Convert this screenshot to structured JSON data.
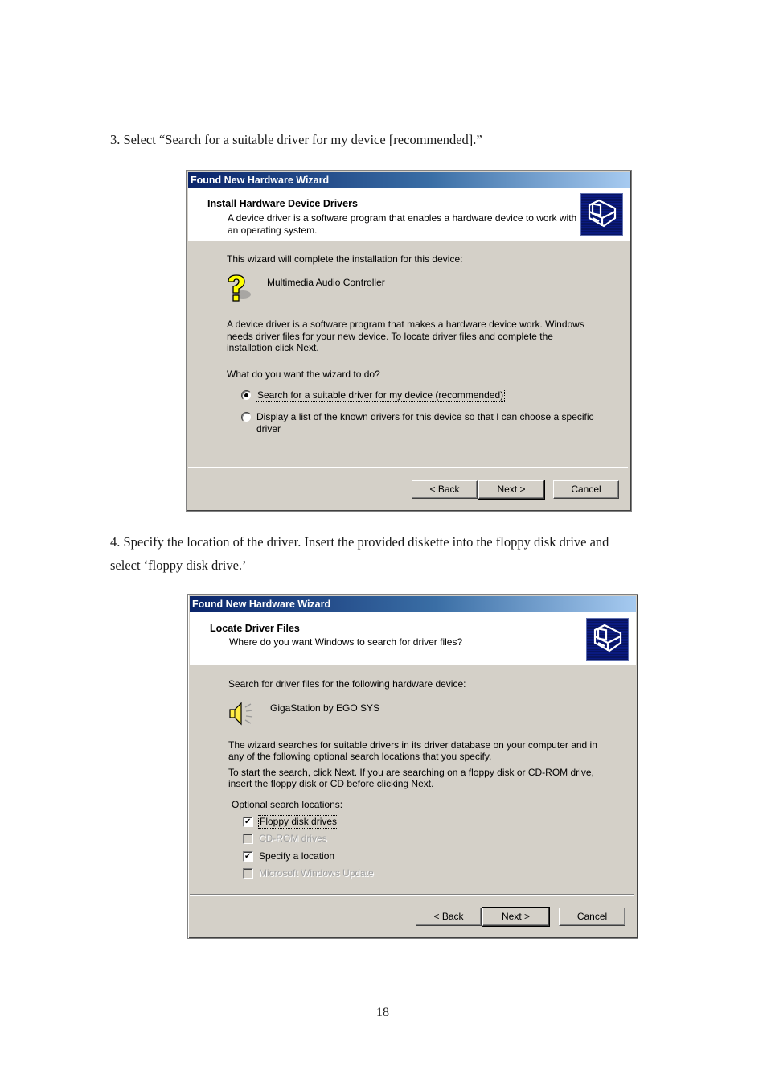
{
  "document": {
    "step3_text": "3. Select “Search for a suitable driver for my device [recommended].”",
    "step4_text_line1": "4. Specify the location of the driver. Insert the provided diskette into the floppy disk drive and",
    "step4_text_line2": "select ‘floppy disk drive.’",
    "page_number": "18"
  },
  "dialog1": {
    "title": "Found New Hardware Wizard",
    "header_title": "Install Hardware Device Drivers",
    "header_sub_line1": "A device driver is a software program that enables a hardware device to work with",
    "header_sub_line2": "an operating system.",
    "header_icon": "hardware-wizard-icon",
    "intro": "This wizard will complete the installation for this device:",
    "device_icon": "unknown-device-question-icon",
    "device_name": "Multimedia Audio Controller",
    "description_line1": "A device driver is a software program that makes a hardware device work. Windows",
    "description_line2": "needs driver files for your new device. To locate driver files and complete the",
    "description_line3": "installation click Next.",
    "question": "What do you want the wizard to do?",
    "options": [
      {
        "label": "Search for a suitable driver for my device (recommended)",
        "selected": true
      },
      {
        "label_line1": "Display a list of the known drivers for this device so that I can choose a specific",
        "label_line2": "driver",
        "selected": false
      }
    ],
    "buttons": {
      "back": "< Back",
      "next": "Next >",
      "cancel": "Cancel"
    }
  },
  "dialog2": {
    "title": "Found New Hardware Wizard",
    "header_title": "Locate Driver Files",
    "header_sub": "Where do you want Windows to search for driver files?",
    "header_icon": "hardware-wizard-icon",
    "intro": "Search for driver files for the following hardware device:",
    "device_icon": "speaker-icon",
    "device_name": "GigaStation by EGO SYS",
    "para1_line1": "The wizard searches for suitable drivers in its driver database on your computer and in",
    "para1_line2": "any of the following optional search locations that you specify.",
    "para2_line1": "To start the search, click Next. If you are searching on a floppy disk or CD-ROM drive,",
    "para2_line2": "insert the floppy disk or CD before clicking Next.",
    "optional_label": "Optional search locations:",
    "checkboxes": [
      {
        "label": "Floppy disk drives",
        "checked": true,
        "enabled": true
      },
      {
        "label": "CD-ROM drives",
        "checked": false,
        "enabled": false
      },
      {
        "label": "Specify a location",
        "checked": true,
        "enabled": true
      },
      {
        "label": "Microsoft Windows Update",
        "checked": false,
        "enabled": false
      }
    ],
    "buttons": {
      "back": "< Back",
      "next": "Next >",
      "cancel": "Cancel"
    }
  }
}
